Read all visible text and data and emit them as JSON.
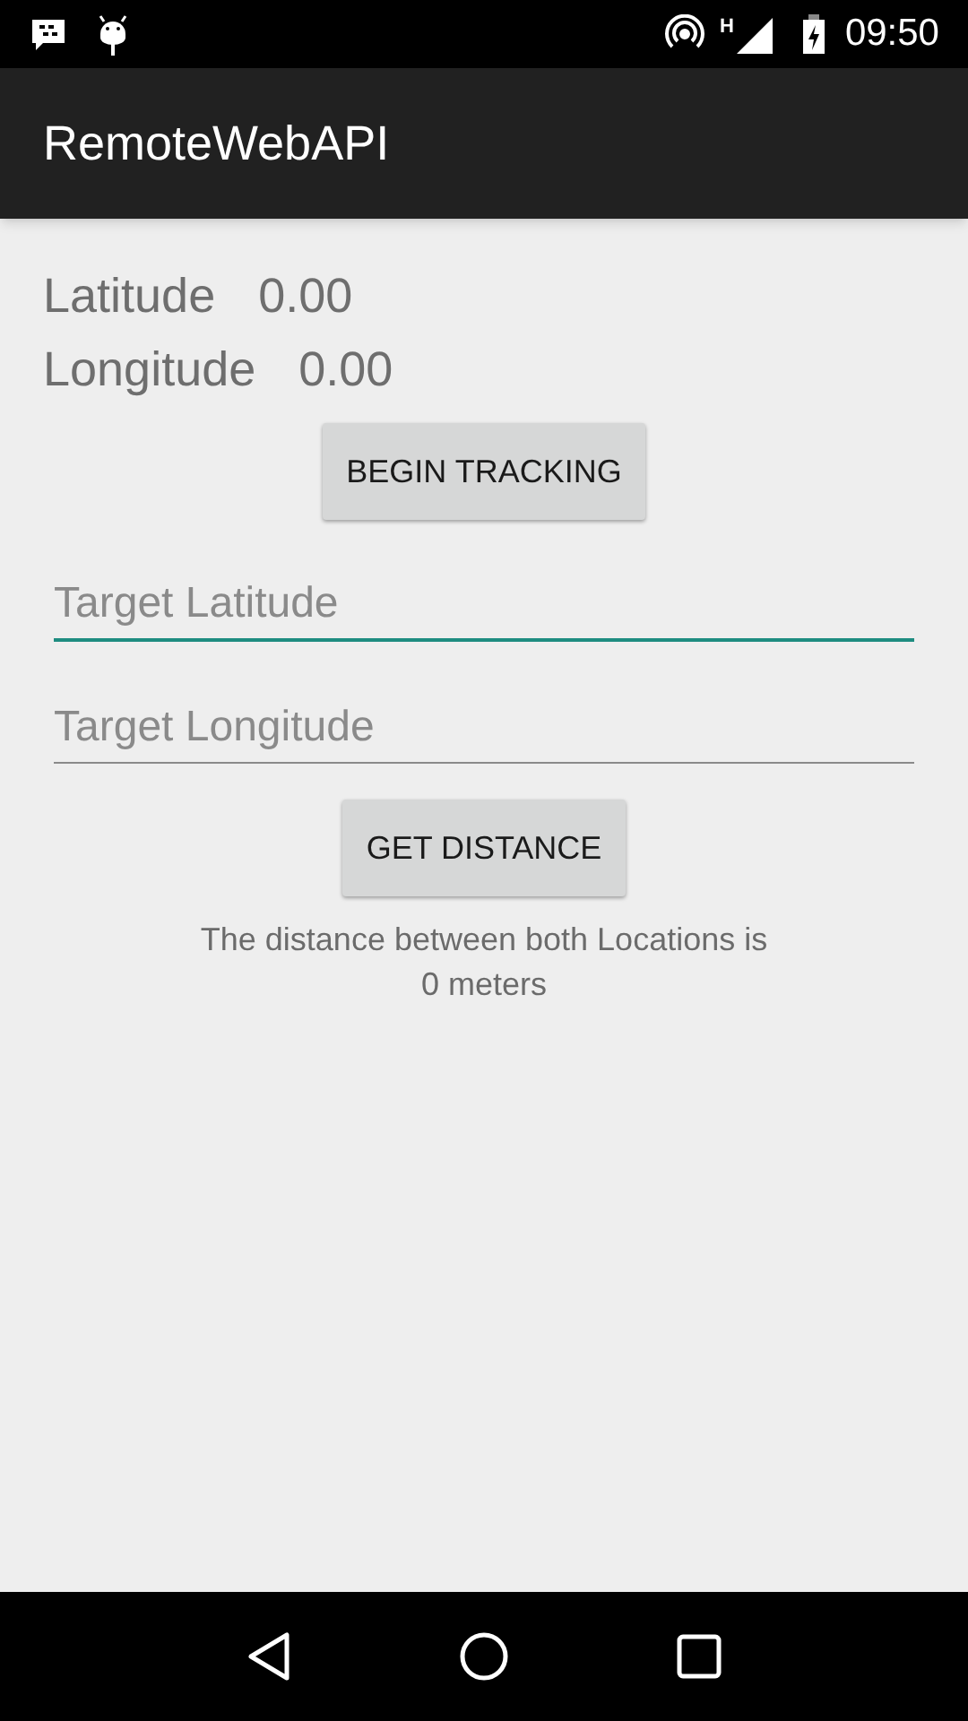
{
  "status_bar": {
    "network_type": "H",
    "time": "09:50"
  },
  "app_bar": {
    "title": "RemoteWebAPI"
  },
  "readings": [
    {
      "label": "Latitude",
      "value": "0.00"
    },
    {
      "label": "Longitude",
      "value": "0.00"
    }
  ],
  "begin_button": "BEGIN TRACKING",
  "fields": [
    {
      "placeholder": "Target Latitude",
      "focused": true
    },
    {
      "placeholder": "Target Longitude",
      "focused": false
    }
  ],
  "distance_button": "GET DISTANCE",
  "result": [
    "The distance between both Locations is",
    "0 meters"
  ]
}
